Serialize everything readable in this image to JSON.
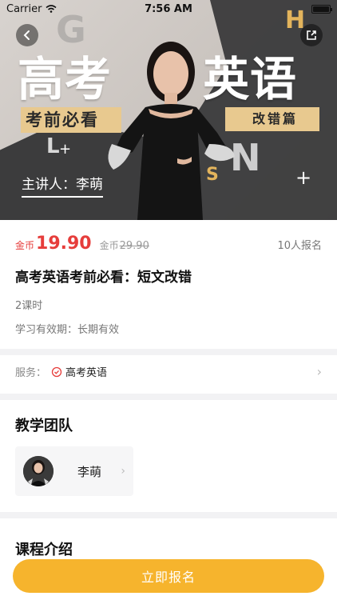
{
  "status_bar": {
    "carrier": "Carrier",
    "time": "7:56 AM"
  },
  "banner": {
    "title_left": "高考",
    "title_right": "英语",
    "tag_left": "考前必看",
    "tag_right": "改错篇",
    "speaker": "主讲人：李萌",
    "decor_letters": [
      "G",
      "H",
      "N",
      "S",
      "L"
    ]
  },
  "course": {
    "coin_label": "金币",
    "price": "19.90",
    "original_label": "金币",
    "original_price": "29.90",
    "enrolled": "10人报名",
    "title": "高考英语考前必看：短文改错",
    "lessons": "2课时",
    "validity": "学习有效期：长期有效"
  },
  "service": {
    "label": "服务：",
    "value": "高考英语"
  },
  "team": {
    "heading": "教学团队",
    "teacher_name": "李萌"
  },
  "intro": {
    "heading": "课程介绍"
  },
  "cta": {
    "label": "立即报名"
  },
  "colors": {
    "accent_red": "#e63d3b",
    "cta_yellow": "#f6b42d",
    "tag_gold": "#e8c98f"
  }
}
